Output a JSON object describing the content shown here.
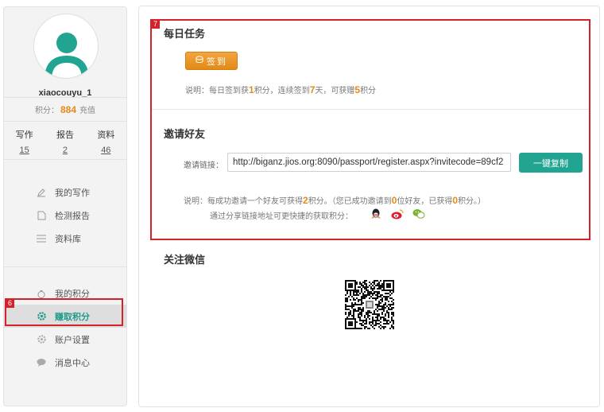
{
  "sidebar": {
    "username": "xiaocouyu_1",
    "points_label": "积分：",
    "points_value": "884",
    "recharge_label": "充值",
    "stats": [
      {
        "label": "写作",
        "value": "15"
      },
      {
        "label": "报告",
        "value": "2"
      },
      {
        "label": "资料",
        "value": "46"
      }
    ],
    "nav_primary": [
      {
        "label": "我的写作",
        "icon": "pencil-icon"
      },
      {
        "label": "检测报告",
        "icon": "document-icon"
      },
      {
        "label": "资料库",
        "icon": "list-icon"
      }
    ],
    "nav_secondary": [
      {
        "label": "我的积分",
        "icon": "money-bag-icon"
      },
      {
        "label": "赚取积分",
        "icon": "gear-icon"
      },
      {
        "label": "账户设置",
        "icon": "settings-icon"
      },
      {
        "label": "消息中心",
        "icon": "chat-icon"
      }
    ]
  },
  "annotations": {
    "mark6": "6",
    "mark7": "7"
  },
  "daily": {
    "title": "每日任务",
    "checkin_label": "签到",
    "note_prefix": "说明：每日签到获",
    "note_n1": "1",
    "note_mid1": "积分，连续签到",
    "note_n2": "7",
    "note_mid2": "天，可获赠",
    "note_n3": "5",
    "note_suffix": "积分"
  },
  "invite": {
    "title": "邀请好友",
    "link_label": "邀请链接：",
    "link_value": "http://biganz.jios.org:8090/passport/register.aspx?invitecode=89cf2",
    "copy_label": "一键复制",
    "note_prefix": "说明：每成功邀请一个好友可获得",
    "note_n1": "2",
    "note_mid1": "积分。（您已成功邀请到",
    "note_n2": "0",
    "note_mid2": "位好友，已获得",
    "note_n3": "0",
    "note_suffix": "积分。）",
    "share_text": "通过分享链接地址可更快捷的获取积分：",
    "share_icons": [
      "qq-icon",
      "weibo-icon",
      "wechat-icon"
    ]
  },
  "wechat": {
    "title": "关注微信"
  }
}
